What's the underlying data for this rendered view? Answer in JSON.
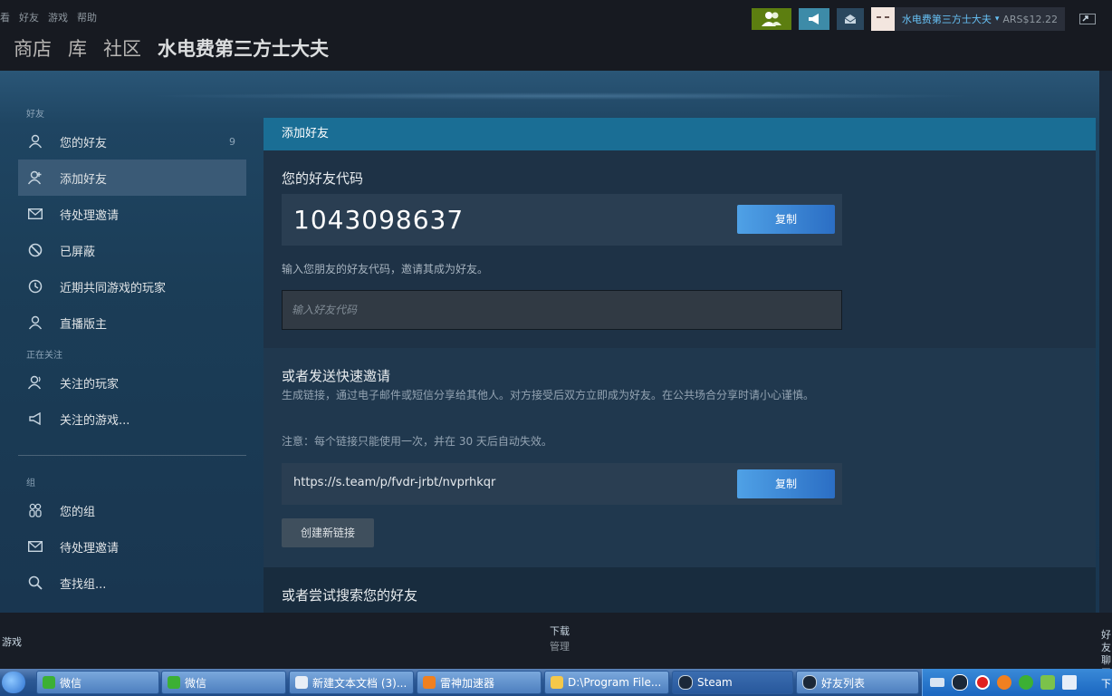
{
  "menu": [
    "看",
    "好友",
    "游戏",
    "帮助"
  ],
  "nav": {
    "store": "商店",
    "library": "库",
    "community": "社区",
    "username": "水电费第三方士大夫"
  },
  "account": {
    "name": "水电费第三方士大夫",
    "balance": "ARS$12.22"
  },
  "sidebar": {
    "friends_header": "好友",
    "friends_items": [
      {
        "label": "您的好友",
        "icon": "person-icon",
        "count": "9"
      },
      {
        "label": "添加好友",
        "icon": "add-person-icon"
      },
      {
        "label": "待处理邀请",
        "icon": "envelope-icon"
      },
      {
        "label": "已屏蔽",
        "icon": "blocked-icon"
      },
      {
        "label": "近期共同游戏的玩家",
        "icon": "clock-icon"
      },
      {
        "label": "直播版主",
        "icon": "person-icon"
      }
    ],
    "following_header": "正在关注",
    "following_items": [
      {
        "label": "关注的玩家",
        "icon": "person-follow-icon"
      },
      {
        "label": "关注的游戏...",
        "icon": "megaphone-icon"
      }
    ],
    "groups_header": "组",
    "groups_items": [
      {
        "label": "您的组",
        "icon": "group-icon"
      },
      {
        "label": "待处理邀请",
        "icon": "envelope-icon"
      },
      {
        "label": "查找组...",
        "icon": "search-icon"
      }
    ]
  },
  "panel": {
    "title": "添加好友",
    "code_heading": "您的好友代码",
    "friend_code": "1043098637",
    "copy_label": "复制",
    "enter_hint": "输入您朋友的好友代码，邀请其成为好友。",
    "input_placeholder": "输入好友代码",
    "invite_heading": "或者发送快速邀请",
    "invite_desc": "生成链接，通过电子邮件或短信分享给其他人。对方接受后双方立即成为好友。在公共场合分享时请小心谨慎。",
    "invite_note": "注意：每个链接只能使用一次，并在 30 天后自动失效。",
    "invite_link": "https://s.team/p/fvdr-jrbt/nvprhkqr",
    "copy_label2": "复制",
    "new_link_label": "创建新链接",
    "search_heading": "或者尝试搜索您的好友"
  },
  "bottombar": {
    "games": "游戏",
    "download_line1": "下载",
    "download_line2": "管理",
    "friends_partial": "好友聊天"
  },
  "taskbar": {
    "items": [
      {
        "label": "微信",
        "icon_color": "#3cb034"
      },
      {
        "label": "微信",
        "icon_color": "#3cb034"
      },
      {
        "label": "新建文本文档 (3)...",
        "icon_color": "#e8eef6"
      },
      {
        "label": "雷神加速器",
        "icon_color": "#f08020"
      },
      {
        "label": "D:\\Program File...",
        "icon_color": "#f4c84a"
      },
      {
        "label": "Steam",
        "icon_color": "#1b2838"
      },
      {
        "label": "好友列表",
        "icon_color": "#1b2838"
      }
    ],
    "clock_partial": "下"
  },
  "colors": {
    "accent": "#1a6e95",
    "copy_button": "#3d86d8",
    "background": "#1b2838",
    "active_item": "#3a5a76"
  }
}
